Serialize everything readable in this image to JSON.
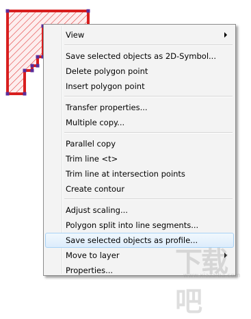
{
  "colors": {
    "shape_fill": "#fdeeee",
    "shape_hatch": "#e33b3b",
    "shape_border": "#d81e1e",
    "vertex_marker": "#5a2d9a",
    "menu_background": "#f3f3f3",
    "menu_highlight": "#dcecfc",
    "menu_highlight_border": "#a8d2f5"
  },
  "context_menu": {
    "groups": [
      [
        {
          "label": "View",
          "has_submenu": true
        }
      ],
      [
        {
          "label": "Save selected objects as 2D-Symbol...",
          "has_submenu": false
        },
        {
          "label": "Delete polygon point",
          "has_submenu": false
        },
        {
          "label": "Insert polygon point",
          "has_submenu": false
        }
      ],
      [
        {
          "label": "Transfer properties...",
          "has_submenu": false
        },
        {
          "label": "Multiple copy...",
          "has_submenu": false
        }
      ],
      [
        {
          "label": "Parallel copy",
          "has_submenu": false
        },
        {
          "label": "Trim line <t>",
          "has_submenu": false
        },
        {
          "label": "Trim line at intersection points",
          "has_submenu": false
        },
        {
          "label": "Create contour",
          "has_submenu": false
        }
      ],
      [
        {
          "label": "Adjust scaling...",
          "has_submenu": false
        },
        {
          "label": "Polygon split into line segments...",
          "has_submenu": false
        },
        {
          "label": "Save selected objects as profile...",
          "has_submenu": false,
          "highlighted": true
        },
        {
          "label": "Move to layer",
          "has_submenu": true
        },
        {
          "label": "Properties...",
          "has_submenu": false
        }
      ]
    ]
  },
  "watermark": {
    "main": "下载吧",
    "sub": "www.xiazaiba.com"
  }
}
